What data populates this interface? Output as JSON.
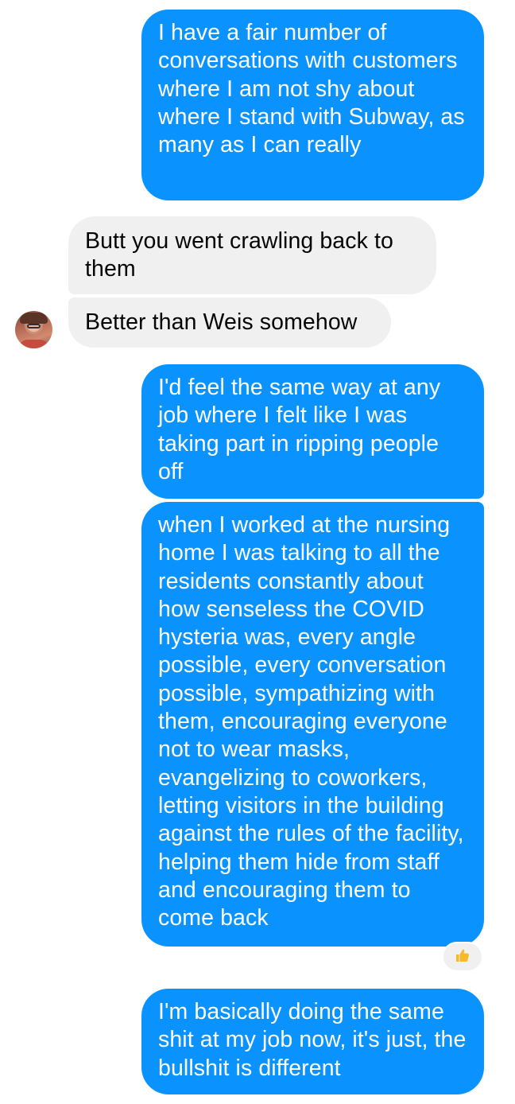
{
  "messages": [
    {
      "sender": "me",
      "text": "I have a fair number of conversations with customers where I am not shy about where I stand with Subway, as many as I can really"
    },
    {
      "sender": "them",
      "text": "Butt you went crawling back to them"
    },
    {
      "sender": "them",
      "text": "Better than Weis somehow"
    },
    {
      "sender": "me",
      "text": "I'd feel the same way at any job where I felt like I was taking part in ripping people off"
    },
    {
      "sender": "me",
      "text": "when I worked at the nursing home I was talking to all the residents constantly about how senseless the COVID hysteria was, every angle possible, every conversation possible, sympathizing with them, encouraging everyone not to wear masks, evangelizing to coworkers, letting visitors in the building against the rules of the facility, helping them hide from staff and encouraging them to come back"
    },
    {
      "sender": "me",
      "text": "I'm basically doing the same shit at my job now, it's just, the bullshit is different"
    }
  ],
  "reaction": {
    "icon": "thumbs-up-icon",
    "color": "#f7b928"
  },
  "colors": {
    "outgoing": "#0a93ff",
    "incoming": "#f0f0f0"
  }
}
